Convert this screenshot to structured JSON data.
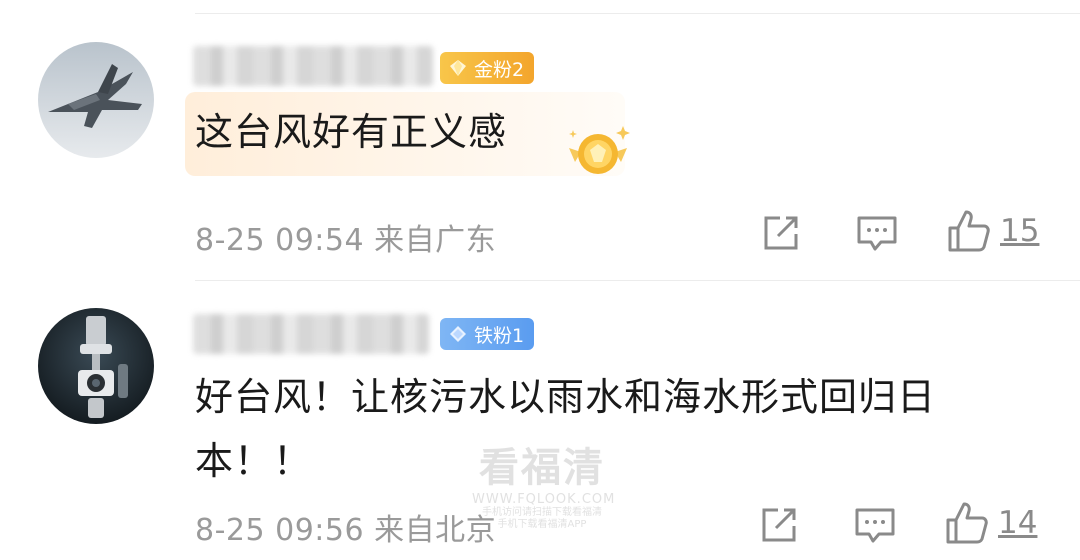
{
  "comments": [
    {
      "badge_label": "金粉2",
      "badge_color": "#f3a52c",
      "text": "这台风好有正义感",
      "meta": "8-25 09:54 来自广东",
      "likes": "15",
      "avatar": "jet-fighter-avatar"
    },
    {
      "badge_label": "铁粉1",
      "badge_color": "#5a9cf0",
      "text_line1": "好台风！让核污水以雨水和海水形式回归日",
      "text_line2": "本！！",
      "meta": "8-25 09:56 来自北京",
      "likes": "14",
      "avatar": "camera-gimbal-avatar"
    }
  ],
  "watermark": {
    "title": "看福清",
    "url": "WWW.FQLOOK.COM",
    "sub1": "手机访问请扫描下载看福清",
    "sub2": "手机下载看福清APP"
  }
}
